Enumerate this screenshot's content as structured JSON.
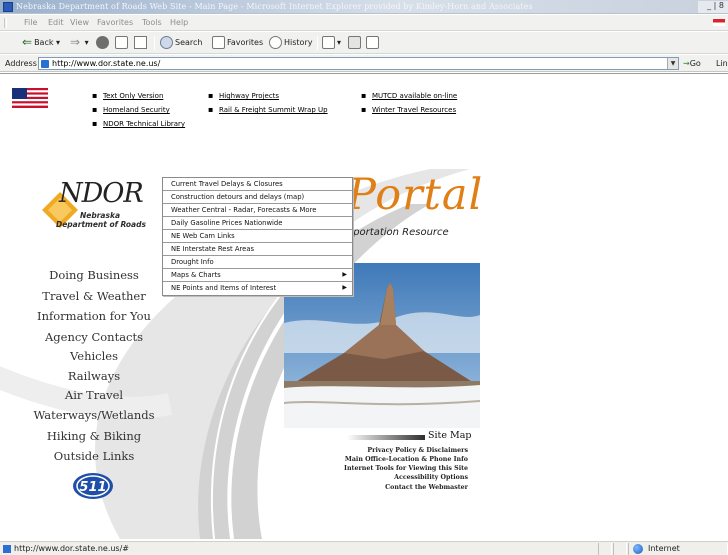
{
  "window": {
    "title": "Nebraska Department of Roads Web Site - Main Page - Microsoft Internet Explorer provided by Kimley-Horn and Associates",
    "controls": "_ | 8"
  },
  "menubar": {
    "items": [
      "File",
      "Edit",
      "View",
      "Favorites",
      "Tools",
      "Help"
    ]
  },
  "toolbar": {
    "back": "Back",
    "search": "Search",
    "favorites": "Favorites",
    "history": "History"
  },
  "address": {
    "label": "Address",
    "url": "http://www.dor.state.ne.us/",
    "go": "Go",
    "links": "Lin"
  },
  "top_links": {
    "col1": [
      "Text Only Version",
      "Homeland Security",
      "NDOR Technical Library"
    ],
    "col2": [
      "Highway Projects",
      "Rail & Freight Summit Wrap Up"
    ],
    "col3": [
      "MUTCD available on-line",
      "Winter Travel Resources"
    ]
  },
  "logo": {
    "word": "NDOR",
    "line1": "Nebraska",
    "line2": "Department of Roads"
  },
  "portal": {
    "title": "Portal",
    "subtitle": "sportation Resource"
  },
  "nav": [
    "Doing Business",
    "Travel & Weather",
    "Information for You",
    "Agency Contacts",
    "Vehicles",
    "Railways",
    "Air Travel",
    "Waterways/Wetlands",
    "Hiking & Biking",
    "Outside Links"
  ],
  "badge": "511",
  "dropdown": [
    {
      "label": "Current Travel Delays & Closures",
      "submenu": false
    },
    {
      "label": "Construction detours and delays (map)",
      "submenu": false
    },
    {
      "label": "Weather Central - Radar, Forecasts & More",
      "submenu": false
    },
    {
      "label": "Daily Gasoline Prices Nationwide",
      "submenu": false
    },
    {
      "label": "NE Web Cam Links",
      "submenu": false
    },
    {
      "label": "NE Interstate Rest Areas",
      "submenu": false
    },
    {
      "label": "Drought Info",
      "submenu": false
    },
    {
      "label": "Maps & Charts",
      "submenu": true
    },
    {
      "label": "NE Points and Items of Interest",
      "submenu": true
    }
  ],
  "footer": {
    "sitemap": "Site Map",
    "links": [
      "Privacy Policy & Disclaimers",
      "Main Office-Location & Phone Info",
      "Internet Tools for Viewing this Site",
      "Accessibility Options",
      "Contact the Webmaster"
    ]
  },
  "status": {
    "text": "http://www.dor.state.ne.us/#",
    "zone": "Internet"
  },
  "colors": {
    "portal_orange": "#e07f16",
    "logo_diamond": "#f0a922",
    "link_blue": "#1f5db9"
  }
}
